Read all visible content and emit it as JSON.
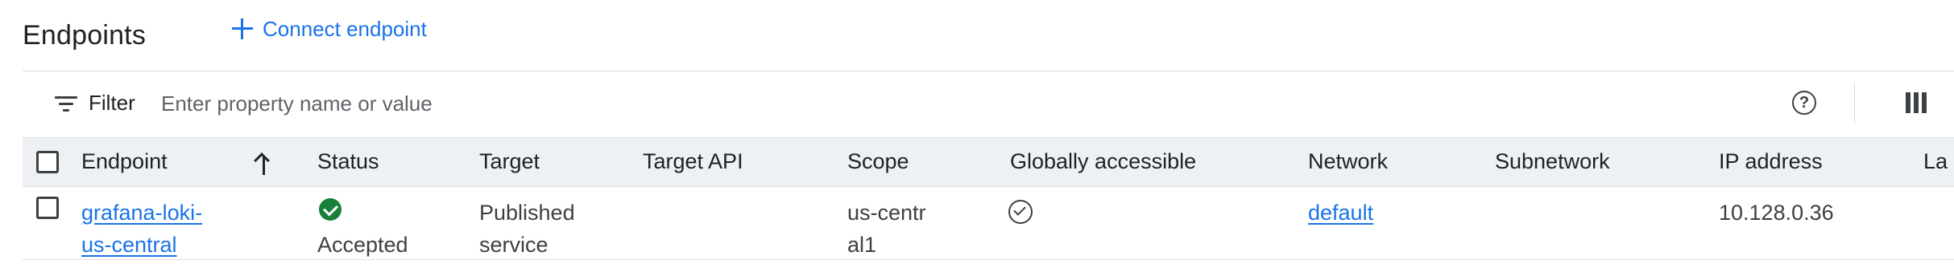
{
  "header": {
    "title": "Endpoints",
    "connect_label": "Connect endpoint"
  },
  "filter": {
    "label": "Filter",
    "placeholder": "Enter property name or value",
    "help_glyph": "?"
  },
  "table": {
    "columns": [
      "Endpoint",
      "Status",
      "Target",
      "Target API",
      "Scope",
      "Globally accessible",
      "Network",
      "Subnetwork",
      "IP address",
      "La"
    ],
    "sort": {
      "column": "Endpoint",
      "direction": "ascending"
    },
    "rows": [
      {
        "endpoint": "grafana-loki-us-central",
        "status": "Accepted",
        "target": "Published service",
        "target_api": "",
        "scope": "us-central1",
        "globally_accessible": true,
        "network": "default",
        "subnetwork": "",
        "ip_address": "10.128.0.36"
      }
    ]
  },
  "colors": {
    "accent": "#1a73e8",
    "success": "#188038",
    "header_bg": "#eef1f4"
  },
  "icons": {
    "connect": "plus-icon",
    "filter": "filter-icon",
    "help": "help-icon",
    "columns": "column-display-icon",
    "sort": "arrow-up-icon",
    "status": "check-circle-filled-icon",
    "global": "check-circle-outline-icon"
  }
}
